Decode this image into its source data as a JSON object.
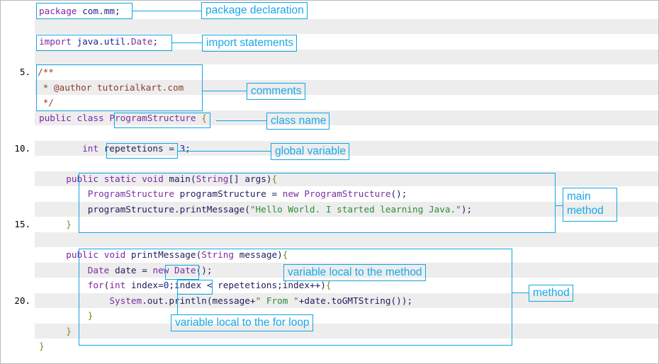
{
  "figure": {
    "title": "Java program structure annotated code listing",
    "accent_color": "#12a5e4",
    "stripe_color": "#ededed",
    "border_color": "#b9b9b9"
  },
  "gutter": {
    "line_numbers": [
      "5.",
      "10.",
      "15.",
      "20."
    ]
  },
  "code": {
    "lines": [
      {
        "n": 1,
        "text": "package com.mm;"
      },
      {
        "n": 2,
        "text": ""
      },
      {
        "n": 3,
        "text": "import java.util.Date;"
      },
      {
        "n": 4,
        "text": ""
      },
      {
        "n": 5,
        "text": "/**"
      },
      {
        "n": 6,
        "text": " * @author tutorialkart.com"
      },
      {
        "n": 7,
        "text": " */"
      },
      {
        "n": 8,
        "text": "public class ProgramStructure {"
      },
      {
        "n": 9,
        "text": ""
      },
      {
        "n": 10,
        "text": "        int repetetions = 3;"
      },
      {
        "n": 11,
        "text": ""
      },
      {
        "n": 12,
        "text": "        public static void main(String[] args){"
      },
      {
        "n": 13,
        "text": "                ProgramStructure programStructure = new ProgramStructure();"
      },
      {
        "n": 14,
        "text": "                programStructure.printMessage(\"Hello World. I started learning Java.\");"
      },
      {
        "n": 15,
        "text": "        }"
      },
      {
        "n": 16,
        "text": ""
      },
      {
        "n": 17,
        "text": "        public void printMessage(String message){"
      },
      {
        "n": 18,
        "text": "                Date date = new Date();"
      },
      {
        "n": 19,
        "text": "                for(int index=0;index < repetetions;index++){"
      },
      {
        "n": 20,
        "text": "                        System.out.println(message+\" From \"+date.toGMTString());"
      },
      {
        "n": 21,
        "text": "                }"
      },
      {
        "n": 22,
        "text": "        }"
      },
      {
        "n": 23,
        "text": "}"
      }
    ]
  },
  "annotations": {
    "package_declaration": "package declaration",
    "import_statements": "import statements",
    "comments": "comments",
    "class_name": "class name",
    "global_variable": "global variable",
    "main_method_line1": "main",
    "main_method_line2": "method",
    "variable_local_method": "variable local to the method",
    "variable_local_for_loop": "variable local to the for loop",
    "method": "method"
  }
}
